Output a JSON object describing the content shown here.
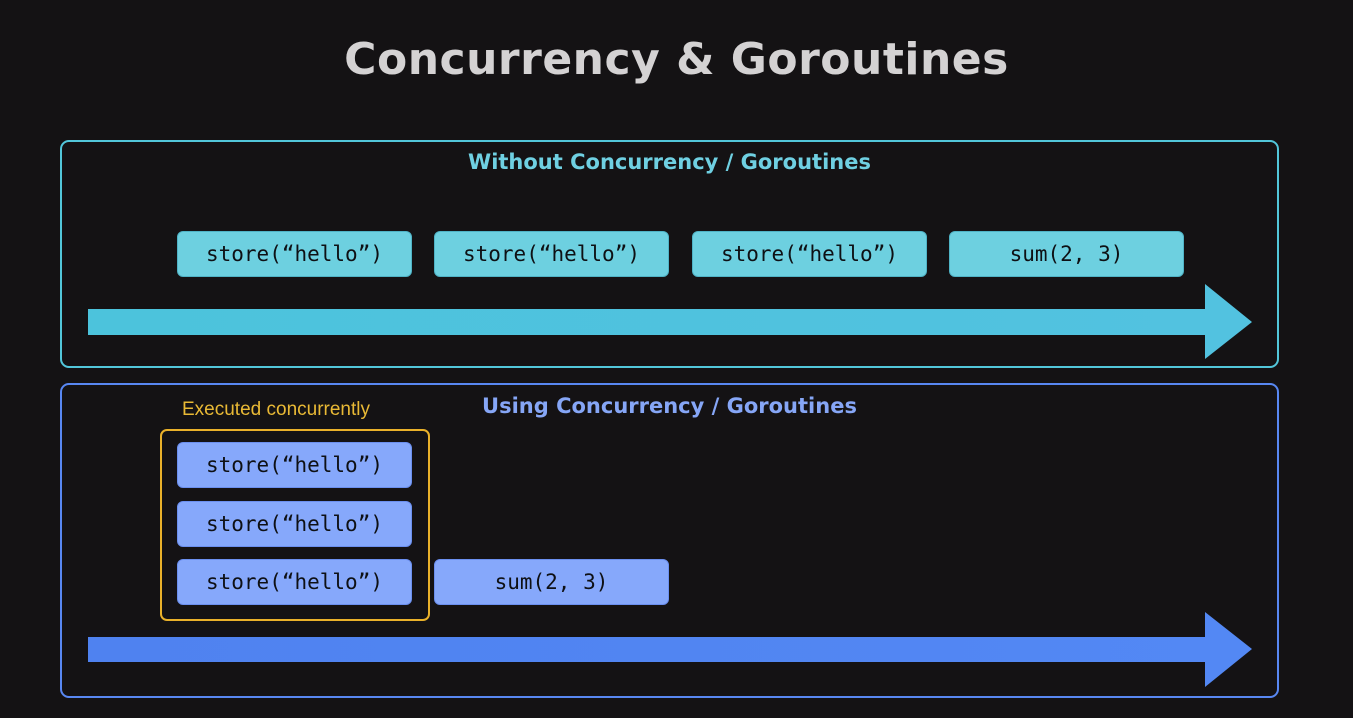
{
  "title": "Concurrency & Goroutines",
  "colors": {
    "background": "#141214",
    "sequential_accent": "#52c6da",
    "concurrent_accent": "#5887f2",
    "group_border": "#eab12a"
  },
  "panel_without": {
    "title": "Without Concurrency / Goroutines",
    "steps": [
      "store(“hello”)",
      "store(“hello”)",
      "store(“hello”)",
      "sum(2, 3)"
    ]
  },
  "panel_with": {
    "title": "Using Concurrency / Goroutines",
    "group_label": "Executed concurrently",
    "concurrent_steps": [
      "store(“hello”)",
      "store(“hello”)",
      "store(“hello”)"
    ],
    "after_step": "sum(2, 3)"
  }
}
